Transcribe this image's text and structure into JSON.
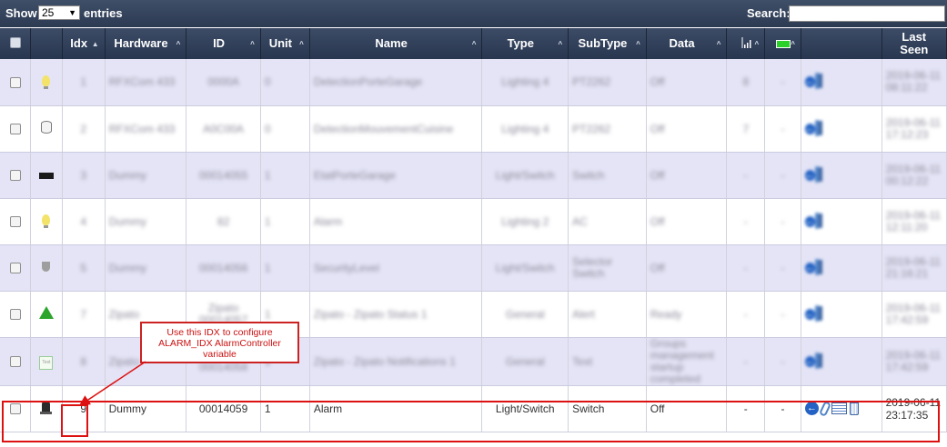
{
  "toolbar": {
    "show_label": "Show",
    "entries_value": "25",
    "entries_label": "entries",
    "search_label": "Search:",
    "search_value": ""
  },
  "columns": [
    {
      "key": "check",
      "label": ""
    },
    {
      "key": "icon",
      "label": ""
    },
    {
      "key": "idx",
      "label": "Idx"
    },
    {
      "key": "hardware",
      "label": "Hardware"
    },
    {
      "key": "id",
      "label": "ID"
    },
    {
      "key": "unit",
      "label": "Unit"
    },
    {
      "key": "name",
      "label": "Name"
    },
    {
      "key": "type",
      "label": "Type"
    },
    {
      "key": "subtype",
      "label": "SubType"
    },
    {
      "key": "data",
      "label": "Data"
    },
    {
      "key": "signal",
      "label": ""
    },
    {
      "key": "battery",
      "label": ""
    },
    {
      "key": "actions",
      "label": ""
    },
    {
      "key": "lastseen",
      "label": "Last Seen"
    }
  ],
  "sort_icons": {
    "idx": "sort-asc-icon",
    "other": "sort-both-icon"
  },
  "rows": [
    {
      "icon": "lightbulb-icon",
      "idx": "1",
      "hardware": "RFXCom 433",
      "id": "0000A",
      "unit": "0",
      "name": "DetectionPorteGarage",
      "type": "Lighting 4",
      "subtype": "PT2262",
      "data": "Off",
      "signal": "8",
      "battery": "-",
      "lastseen": "2019-06-11 08:11:22"
    },
    {
      "icon": "cylinder-icon",
      "idx": "2",
      "hardware": "RFXCom 433",
      "id": "A0C00A",
      "unit": "0",
      "name": "DetectionMouvementCuisine",
      "type": "Lighting 4",
      "subtype": "PT2262",
      "data": "Off",
      "signal": "7",
      "battery": "-",
      "lastseen": "2019-06-11 17:12:23"
    },
    {
      "icon": "black-rectangle-icon",
      "idx": "3",
      "hardware": "Dummy",
      "id": "00014055",
      "unit": "1",
      "name": "EtatPorteGarage",
      "type": "Light/Switch",
      "subtype": "Switch",
      "data": "Off",
      "signal": "-",
      "battery": "-",
      "lastseen": "2019-06-11 00:12:22"
    },
    {
      "icon": "lightbulb-icon",
      "idx": "4",
      "hardware": "Dummy",
      "id": "82",
      "unit": "1",
      "name": "Alarm",
      "type": "Lighting 2",
      "subtype": "AC",
      "data": "Off",
      "signal": "-",
      "battery": "-",
      "lastseen": "2019-06-11 12:11:20"
    },
    {
      "icon": "shield-icon",
      "idx": "5",
      "hardware": "Dummy",
      "id": "00014056",
      "unit": "1",
      "name": "SecurityLevel",
      "type": "Light/Switch",
      "subtype": "Selector Switch",
      "data": "Off",
      "signal": "-",
      "battery": "-",
      "lastseen": "2019-06-11 21:16:21"
    },
    {
      "icon": "warning-triangle-icon",
      "idx": "7",
      "hardware": "Zipato",
      "id": "Zipato 00014057",
      "unit": "1",
      "name": "Zipato - Zipato Status 1",
      "type": "General",
      "subtype": "Alert",
      "data": "Ready",
      "signal": "-",
      "battery": "-",
      "lastseen": "2019-06-11 17:42:59"
    },
    {
      "icon": "text-document-icon",
      "idx": "8",
      "hardware": "Zipato",
      "id": "Zipato 00014058",
      "unit": "1",
      "name": "Zipato - Zipato Notifications 1",
      "type": "General",
      "subtype": "Text",
      "data": "Groups management startup completed",
      "signal": "-",
      "battery": "-",
      "lastseen": "2019-06-11 17:42:59"
    },
    {
      "icon": "siren-icon",
      "idx": "9",
      "hardware": "Dummy",
      "id": "00014059",
      "unit": "1",
      "name": "Alarm",
      "type": "Light/Switch",
      "subtype": "Switch",
      "data": "Off",
      "signal": "-",
      "battery": "-",
      "lastseen": "2019-06-11 23:17:35"
    }
  ],
  "row_action_icons": [
    "log-icon",
    "edit-icon",
    "table-icon",
    "trash-icon"
  ],
  "annotation": {
    "callout_text": "Use this IDX to configure ALARM_IDX AlarmController variable",
    "color": "#dd1111"
  },
  "colors": {
    "header_bg": "#2c3a52",
    "row_odd": "#e4e4f6",
    "row_even": "#ffffff",
    "battery_green": "#2ad12a"
  }
}
